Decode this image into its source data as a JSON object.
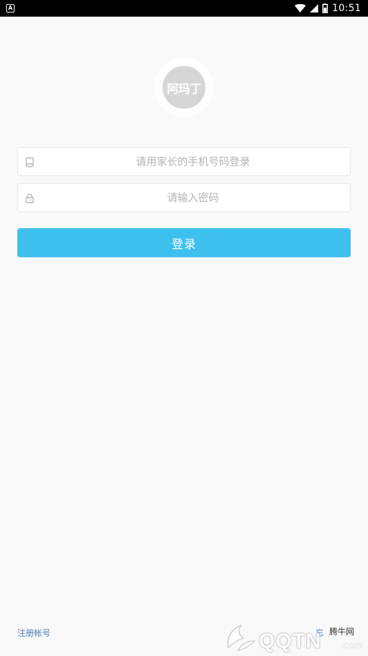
{
  "status_bar": {
    "app_icon_letter": "A",
    "time": "10:51"
  },
  "logo": {
    "text": "阿玛丁"
  },
  "form": {
    "phone_placeholder": "请用家长的手机号码登录",
    "phone_value": "",
    "password_placeholder": "请输入密码",
    "password_value": "",
    "login_label": "登录"
  },
  "footer": {
    "register_label": "注册帐号",
    "forgot_label": "忘"
  },
  "watermark": {
    "site_name": "腾牛网",
    "logo_text": "QQTN",
    "domain_suffix": ".com"
  }
}
